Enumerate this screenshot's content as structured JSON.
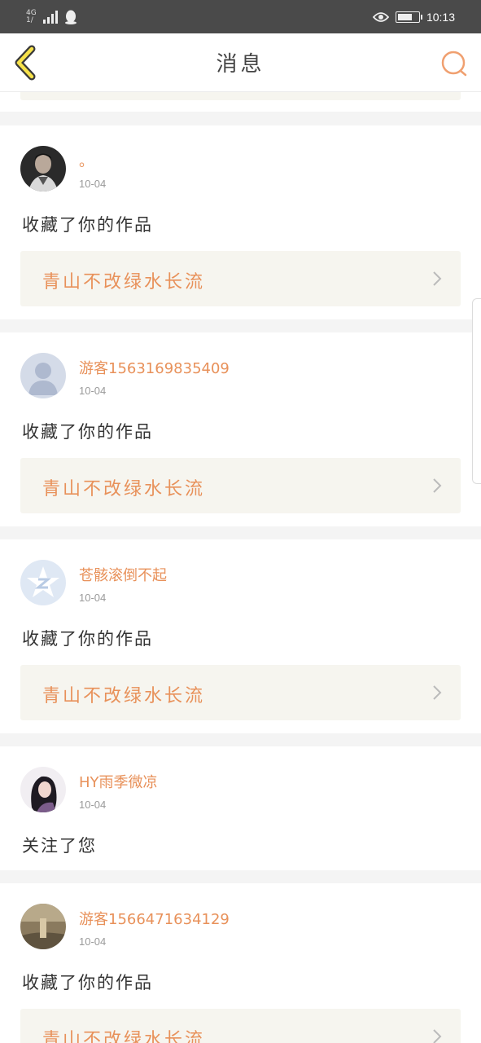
{
  "status_bar": {
    "network_top": "4G",
    "network_bottom": "1/",
    "time": "10:13",
    "battery_level": 0.7
  },
  "nav": {
    "title": "消息",
    "back_icon": "chevron-left-icon",
    "search_icon": "search-icon"
  },
  "colors": {
    "accent": "#e8915a",
    "status_bar_bg": "#4a4a4a",
    "back_icon_stroke": "#3a3a3a",
    "back_icon_fill": "#f7e24a",
    "work_box_bg": "#f6f5ef"
  },
  "messages": [
    {
      "user": "。",
      "time": "10-04",
      "action": "收藏了你的作品",
      "work": "青山不改绿水长流",
      "avatar": "photo-avatar-man"
    },
    {
      "user": "游客1563169835409",
      "time": "10-04",
      "action": "收藏了你的作品",
      "work": "青山不改绿水长流",
      "avatar": "default-avatar"
    },
    {
      "user": "苍骸滚倒不起",
      "time": "10-04",
      "action": "收藏了你的作品",
      "work": "青山不改绿水长流",
      "avatar": "qzone-star-avatar"
    },
    {
      "user": "HY雨季微凉",
      "time": "10-04",
      "action": "关注了您",
      "work": "",
      "avatar": "photo-avatar-girl"
    },
    {
      "user": "游客1566471634129",
      "time": "10-04",
      "action": "收藏了你的作品",
      "work": "青山不改绿水长流",
      "avatar": "photo-avatar-landscape"
    }
  ]
}
